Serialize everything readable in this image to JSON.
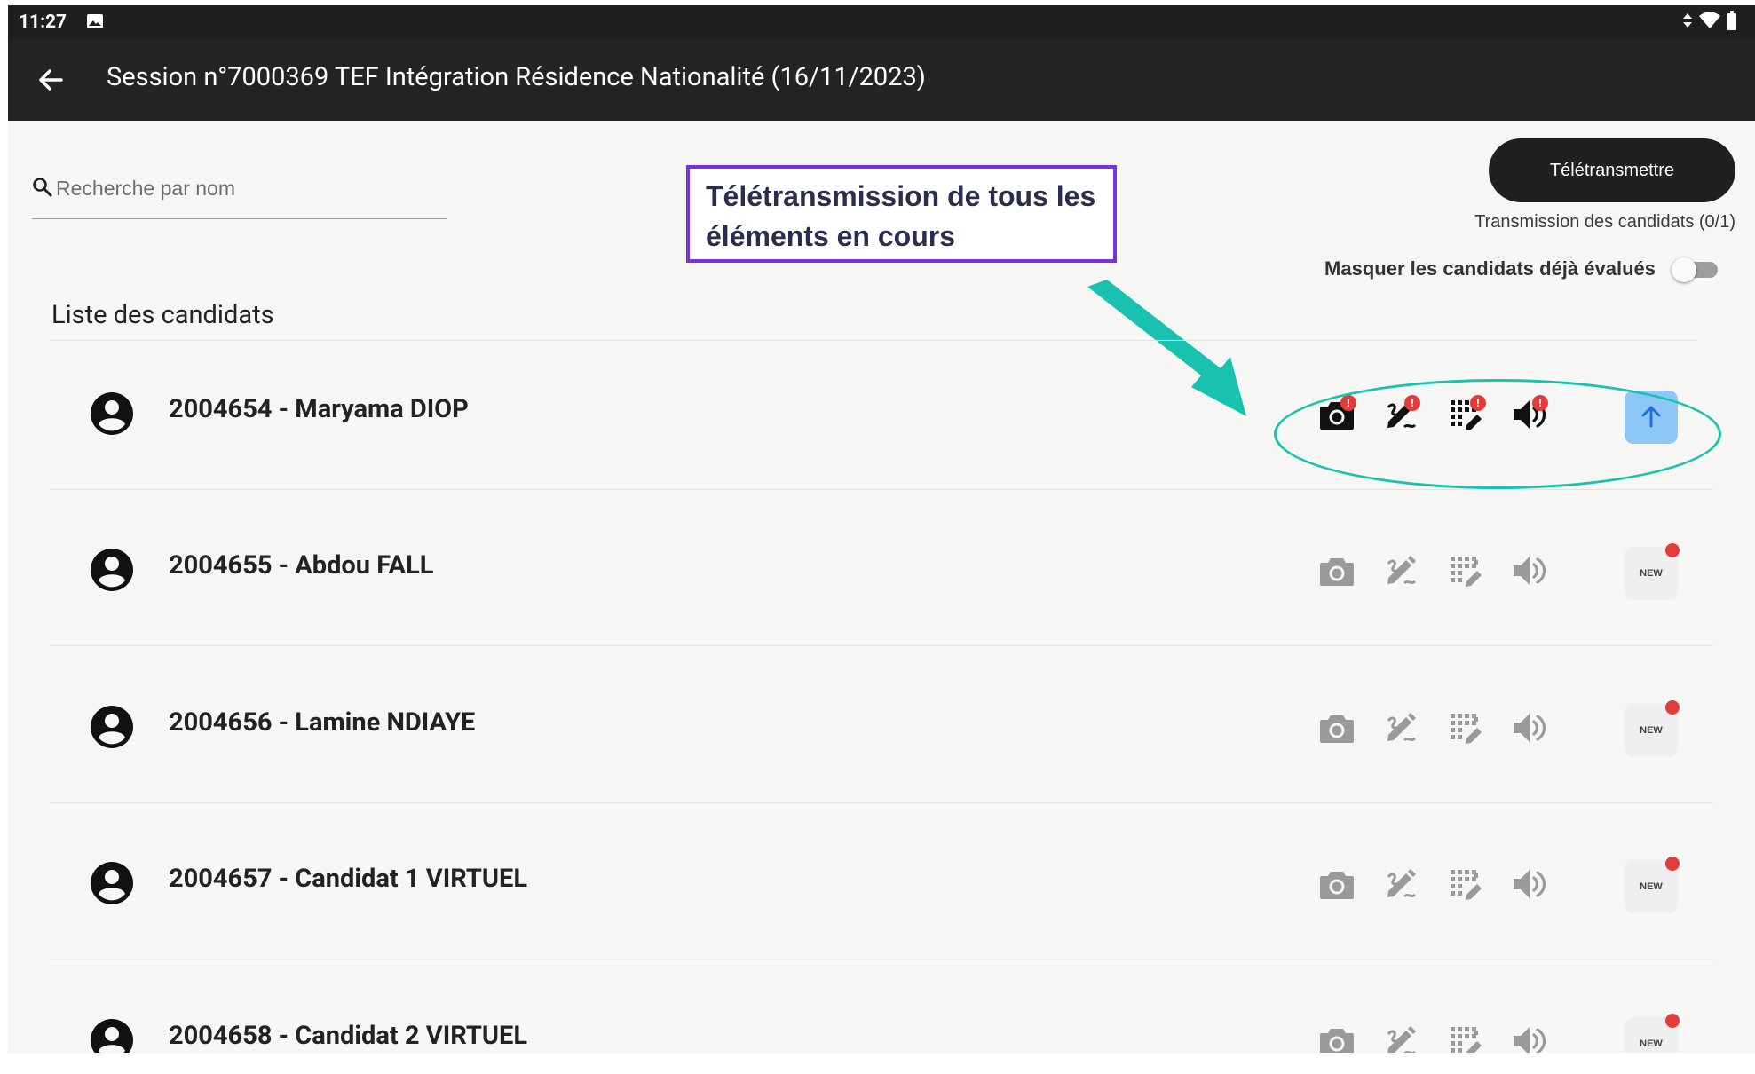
{
  "status_bar": {
    "time": "11:27"
  },
  "app_bar": {
    "title": "Session n°7000369 TEF Intégration Résidence Nationalité (16/11/2023)"
  },
  "search": {
    "placeholder": "Recherche par nom"
  },
  "callout": {
    "line1": "Télétransmission de tous les",
    "line2": "éléments en cours"
  },
  "actions": {
    "transmit_label": "Télétransmettre",
    "transmission_status": "Transmission des candidats (0/1)",
    "hide_evaluated_label": "Masquer les candidats déjà évalués",
    "hide_evaluated_on": false
  },
  "list": {
    "title": "Liste des candidats",
    "candidates": [
      {
        "label": "2004654 - Maryama DIOP",
        "state": "pending",
        "action": "upload"
      },
      {
        "label": "2004655 - Abdou FALL",
        "state": "new",
        "action": "NEW"
      },
      {
        "label": "2004656 - Lamine NDIAYE",
        "state": "new",
        "action": "NEW"
      },
      {
        "label": "2004657 - Candidat 1 VIRTUEL",
        "state": "new",
        "action": "NEW"
      },
      {
        "label": "2004658 - Candidat 2 VIRTUEL",
        "state": "new",
        "action": "NEW"
      }
    ]
  },
  "row_icons": [
    "camera-icon",
    "signature-icon",
    "answer-grid-icon",
    "audio-icon"
  ],
  "colors": {
    "status_bar": "#1f1f1f",
    "app_bar": "#242424",
    "background": "#f6f7f4",
    "transmit_button": "#202020",
    "upload_button": "#8ec6f5",
    "alert_badge": "#e33a3a",
    "callout_border": "#7a2ee6",
    "annotation_teal": "#18c2ae",
    "inactive_icon": "#9a9a9a",
    "active_icon": "#111111"
  }
}
